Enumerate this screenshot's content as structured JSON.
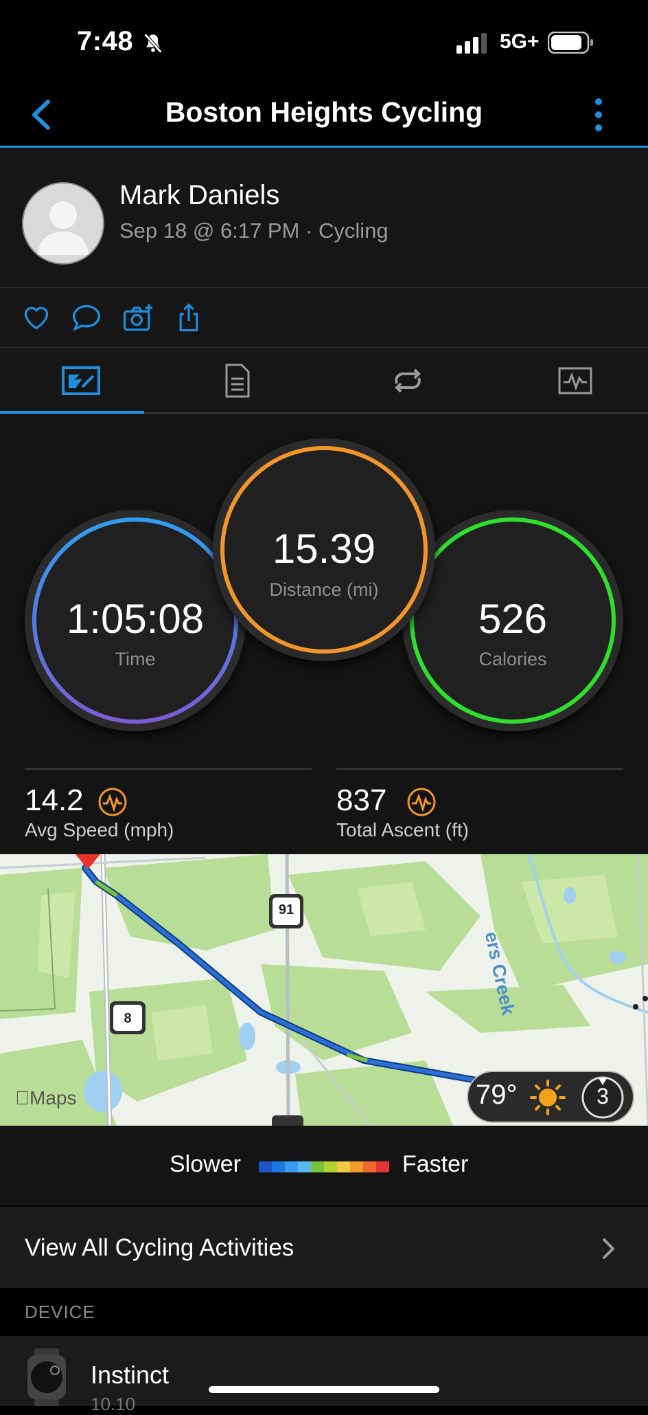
{
  "status_bar": {
    "time": "7:48",
    "network": "5G+"
  },
  "nav": {
    "title": "Boston Heights Cycling"
  },
  "profile": {
    "name": "Mark Daniels",
    "meta": "Sep 18 @ 6:17 PM · Cycling"
  },
  "stats": {
    "time": {
      "value": "1:05:08",
      "label": "Time"
    },
    "distance": {
      "value": "15.39",
      "label": "Distance (mi)"
    },
    "calories": {
      "value": "526",
      "label": "Calories"
    },
    "avg_speed": {
      "value": "14.2",
      "label": "Avg Speed (mph)"
    },
    "total_ascent": {
      "value": "837",
      "label": "Total Ascent (ft)"
    }
  },
  "map": {
    "attribution": "Maps",
    "route_91": "91",
    "route_8": "8",
    "creek_label": "ers Creek",
    "weather_temp": "79°",
    "wind_value": "3"
  },
  "legend": {
    "slower": "Slower",
    "faster": "Faster",
    "colors": [
      "#1e55c8",
      "#1f78e0",
      "#3a9cf0",
      "#58b8f2",
      "#79c23a",
      "#b6d232",
      "#f2c94a",
      "#f29b2a",
      "#ef6a2a",
      "#e23434"
    ]
  },
  "view_all": {
    "label": "View All Cycling Activities"
  },
  "device": {
    "section_label": "DEVICE",
    "name": "Instinct",
    "sub": "10.10"
  },
  "colors": {
    "accent": "#1f8fe0",
    "time_ring": "#3b8fe8",
    "distance_ring": "#f3962a",
    "calories_ring": "#2ee02e",
    "route": "#2a6fd6"
  }
}
